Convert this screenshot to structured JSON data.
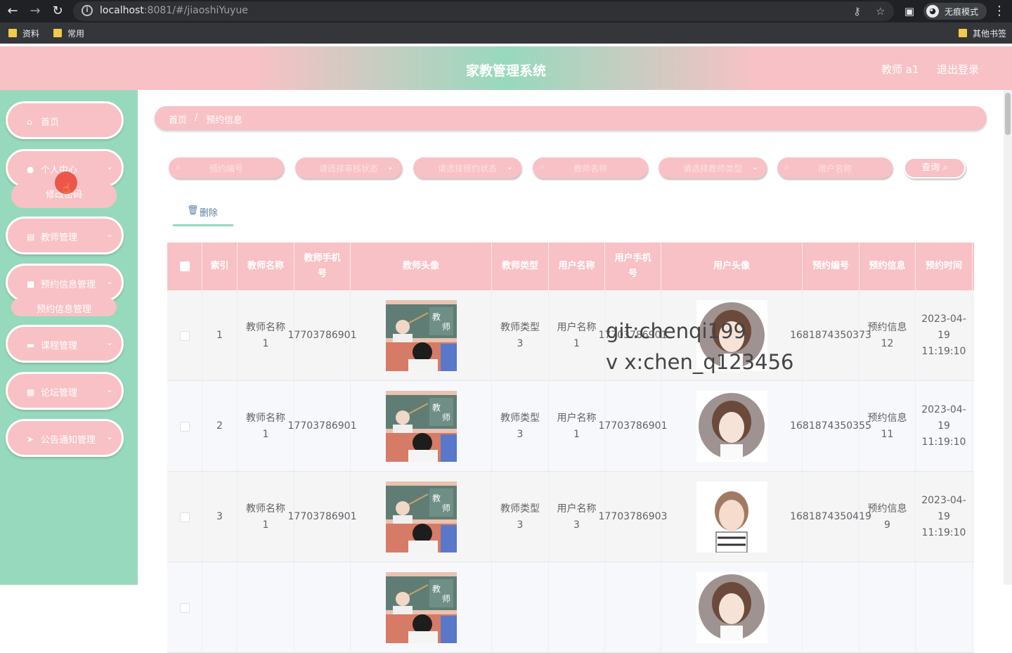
{
  "browser": {
    "url_host": "localhost",
    "url_rest": ":8081/#/jiaoshiYuyue",
    "incognito_label": "无痕模式",
    "bookmarks": [
      "资料",
      "常用"
    ],
    "other_bookmarks": "其他书签"
  },
  "header": {
    "title": "家教管理系统",
    "user": "教师 a1",
    "logout": "退出登录"
  },
  "sidebar": {
    "items": [
      {
        "label": "首页",
        "icon": "home-icon"
      },
      {
        "label": "个人中心",
        "icon": "user-icon"
      },
      {
        "label": "教师管理",
        "icon": "list-icon"
      },
      {
        "label": "预约信息管理",
        "icon": "video-icon"
      },
      {
        "label": "课程管理",
        "icon": "briefcase-icon"
      },
      {
        "label": "论坛管理",
        "icon": "grid-icon"
      },
      {
        "label": "公告通知管理",
        "icon": "send-icon"
      }
    ],
    "sub_personal": "修改密码",
    "sub_booking": "预约信息管理"
  },
  "breadcrumb": {
    "home": "首页",
    "sep": "/",
    "current": "预约信息"
  },
  "filters": {
    "booking_no": "预约编号",
    "review_status": "请选择审核状态",
    "booking_status": "请选择预约状态",
    "teacher_name": "教师名称",
    "teacher_type": "请选择教师类型",
    "user_name": "用户名称",
    "search": "查询"
  },
  "toolbar": {
    "delete": "删除"
  },
  "table": {
    "headers": [
      "索引",
      "教师名称",
      "教师手机号",
      "教师头像",
      "教师类型",
      "用户名称",
      "用户手机号",
      "用户头像",
      "预约编号",
      "预约信息",
      "预约时间"
    ],
    "rows": [
      {
        "index": "1",
        "teacher_name": "教师名称1",
        "teacher_phone": "17703786901",
        "teacher_type": "教师类型3",
        "user_name": "用户名称1",
        "user_phone": "17703786901",
        "booking_no": "1681874350373",
        "booking_info": "预约信息12",
        "booking_time": "2023-04-19 11:19:10"
      },
      {
        "index": "2",
        "teacher_name": "教师名称1",
        "teacher_phone": "17703786901",
        "teacher_type": "教师类型3",
        "user_name": "用户名称1",
        "user_phone": "17703786901",
        "booking_no": "1681874350355",
        "booking_info": "预约信息11",
        "booking_time": "2023-04-19 11:19:10"
      },
      {
        "index": "3",
        "teacher_name": "教师名称1",
        "teacher_phone": "17703786901",
        "teacher_type": "教师类型3",
        "user_name": "用户名称3",
        "user_phone": "17703786903",
        "booking_no": "1681874350419",
        "booking_info": "预约信息9",
        "booking_time": "2023-04-19 11:19:10"
      }
    ]
  },
  "watermark": {
    "line1": "git:chenqi199",
    "line2": "v x:chen_q123456"
  },
  "colors": {
    "pink": "#f8c1c5",
    "mint": "#97d9bd"
  }
}
